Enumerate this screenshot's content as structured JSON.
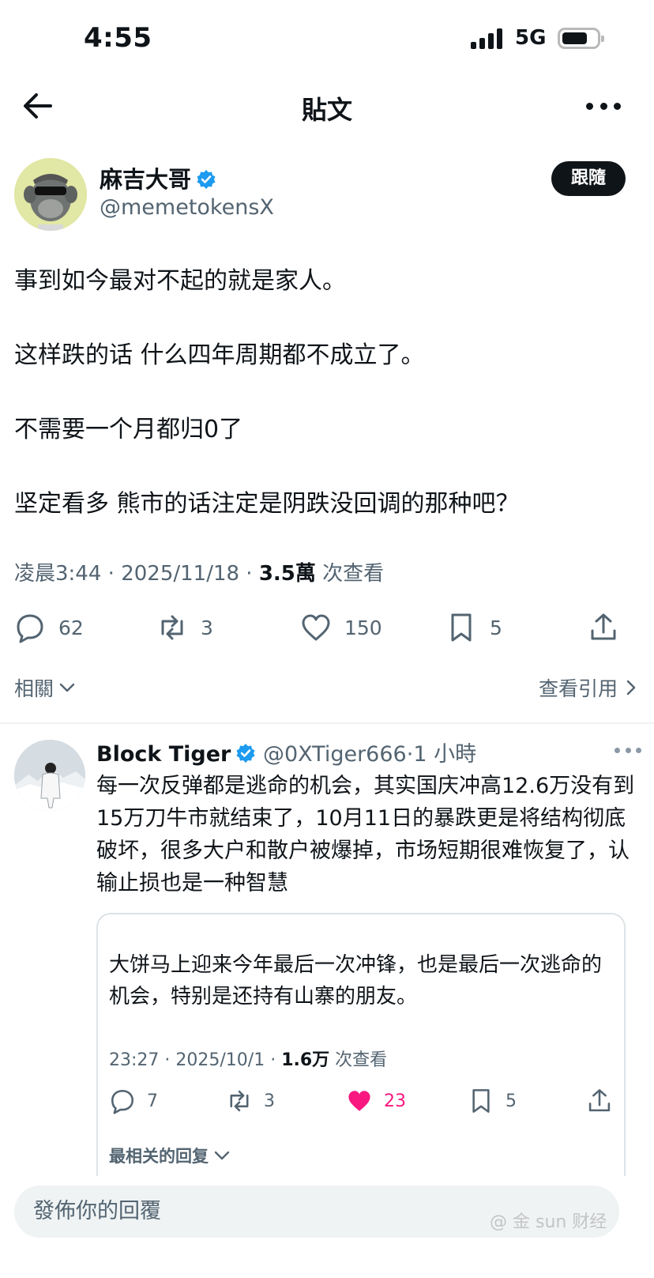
{
  "status_bar": {
    "time": "4:55",
    "network": "5G"
  },
  "nav": {
    "title": "貼文",
    "back_icon": "arrow-left-icon",
    "more_icon": "more-horizontal-icon"
  },
  "author": {
    "name": "麻吉大哥",
    "handle": "@memetokensX",
    "verified": true,
    "follow_label": "跟隨"
  },
  "post": {
    "lines": [
      "事到如今最对不起的就是家人。",
      "这样跌的话 什么四年周期都不成立了。",
      "不需要一个月都归0了",
      "坚定看多 熊市的话注定是阴跌没回调的那种吧？"
    ],
    "time": "凌晨3:44",
    "date": "2025/11/18",
    "views": "3.5萬",
    "views_label": "次查看",
    "replies": "62",
    "reposts": "3",
    "likes": "150",
    "bookmarks": "5"
  },
  "related": {
    "left_label": "相關",
    "right_label": "查看引用"
  },
  "reply": {
    "name": "Block Tiger",
    "handle": "@0XTiger666",
    "age": "1 小時",
    "verified": true,
    "text": "每一次反弹都是逃命的机会，其实国庆冲高12.6万没有到15万刀牛市就结束了，10月11日的暴跌更是将结构彻底破坏，很多大户和散户被爆掉，市场短期很难恢复了，认输止损也是一种智慧",
    "quote": {
      "text": "大饼马上迎来今年最后一次冲锋，也是最后一次逃命的机会，特别是还持有山寨的朋友。",
      "time": "23:27",
      "date": "2025/10/1",
      "views": "1.6万",
      "views_label": "次查看",
      "replies": "7",
      "reposts": "3",
      "likes": "23",
      "bookmarks": "5",
      "related_label": "最相关的回复"
    }
  },
  "composer": {
    "placeholder": "發佈你的回覆"
  },
  "watermark": "@ 金 sun 财经"
}
